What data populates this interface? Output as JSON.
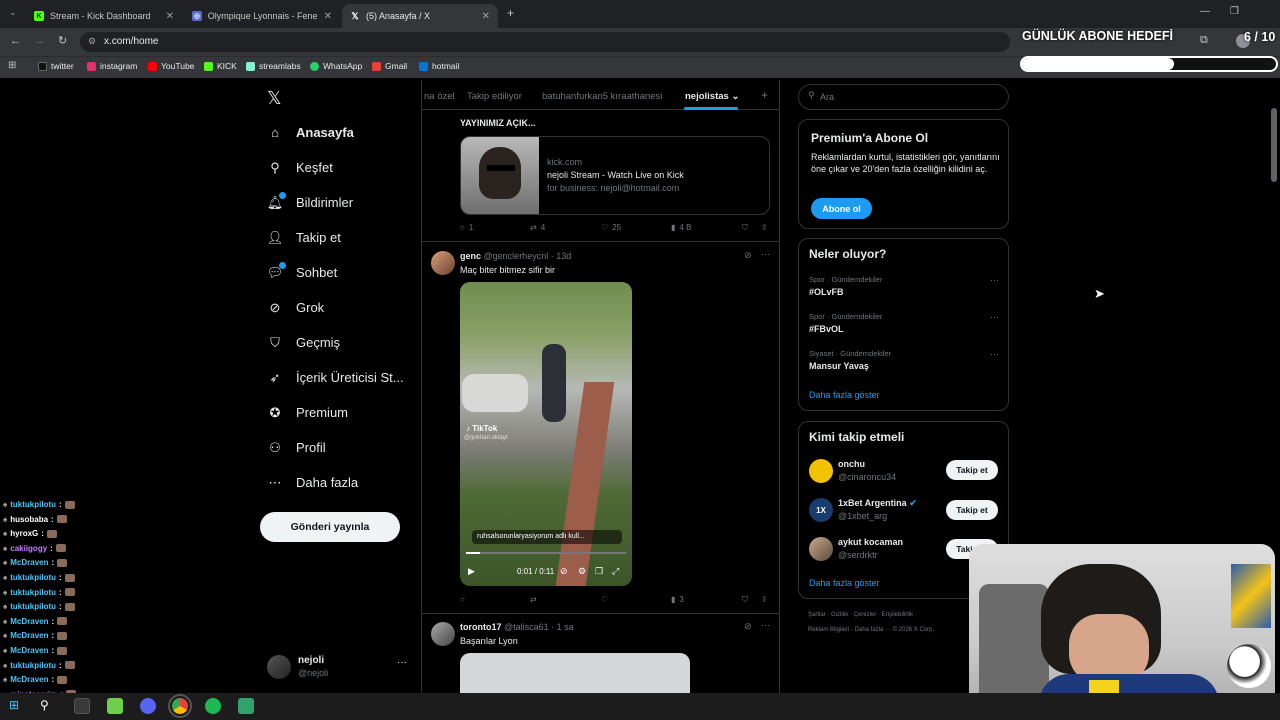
{
  "browser": {
    "tabs": [
      {
        "title": "Stream - Kick Dashboard",
        "icon": "kick-icon",
        "active": false
      },
      {
        "title": "Olympique Lyonnais - Fenerbahçe",
        "icon": "globe-icon",
        "active": false
      },
      {
        "title": "(5) Anasayfa / X",
        "icon": "x-logo-icon",
        "active": true
      }
    ],
    "new_tab": "+",
    "url": "x.com/home",
    "bookmarks": [
      {
        "label": "twitter",
        "color": "#000000"
      },
      {
        "label": "instagram",
        "color": "#e1306c"
      },
      {
        "label": "YouTube",
        "color": "#ff0000"
      },
      {
        "label": "KICK",
        "color": "#53fc18"
      },
      {
        "label": "streamlabs",
        "color": "#80f5d2"
      },
      {
        "label": "WhatsApp",
        "color": "#25d366"
      },
      {
        "label": "Gmail",
        "color": "#ea4335"
      },
      {
        "label": "hotmail",
        "color": "#0078d4"
      }
    ]
  },
  "overlay": {
    "goal_title": "GÜNLÜK ABONE HEDEFİ",
    "goal_count": "6 / 10",
    "goal_progress": 0.6
  },
  "sidebar": {
    "items": [
      {
        "label": "Anasayfa",
        "icon": "home-icon"
      },
      {
        "label": "Keşfet",
        "icon": "search-icon"
      },
      {
        "label": "Bildirimler",
        "icon": "bell-icon"
      },
      {
        "label": "Takip et",
        "icon": "add-user-icon"
      },
      {
        "label": "Sohbet",
        "icon": "chat-icon"
      },
      {
        "label": "Grok",
        "icon": "grok-icon"
      },
      {
        "label": "Geçmiş",
        "icon": "bookmark-icon"
      },
      {
        "label": "İçerik Üreticisi St...",
        "icon": "rocket-icon"
      },
      {
        "label": "Premium",
        "icon": "verified-icon"
      },
      {
        "label": "Profil",
        "icon": "person-icon"
      },
      {
        "label": "Daha fazla",
        "icon": "more-circle-icon"
      }
    ],
    "post_button": "Gönderi yayınla",
    "account": {
      "name": "nejoli",
      "handle": "@nejoli",
      "more": "···"
    }
  },
  "feed": {
    "tabs": [
      "na özel",
      "Takip ediliyor",
      "batuhanfurkan5 kıraathanesi",
      "nejolistas"
    ],
    "add_tab": "+",
    "post1": {
      "text": "YAYINIMIZ AÇIK...",
      "link_domain": "kick.com",
      "link_title": "nejoli Stream - Watch Live on Kick",
      "link_desc": "for business: nejoli@hotmail.com",
      "replies": "1",
      "reposts": "4",
      "likes": "25",
      "views": "4 B"
    },
    "post2": {
      "name": "genc",
      "meta": "@genclerheycnl · 13d",
      "text": "Maç biter bitmez sifir bir",
      "video_watermark": "TikTok",
      "video_user": "@gokhan.oktayt",
      "video_caption": "ruhsalsorunlaryasiyorum adlı kull...",
      "time": "0:01 / 0:11",
      "replies": "",
      "reposts": "",
      "likes": "",
      "views": "3"
    },
    "post3": {
      "name": "toronto17",
      "meta": "@talisca61 · 1 sa",
      "text": "Başarılar Lyon"
    }
  },
  "right": {
    "search_placeholder": "Ara",
    "premium": {
      "title": "Premium'a Abone Ol",
      "desc": "Reklamlardan kurtul, istatistikleri gör, yanıtlarını öne çıkar ve 20'den fazla özelliğin kilidini aç.",
      "button": "Abone ol"
    },
    "trends": {
      "title": "Neler oluyor?",
      "items": [
        {
          "category": "Spor · Gündemdekiler",
          "name": "#OLvFB"
        },
        {
          "category": "Spor · Gündemdekiler",
          "name": "#FBvOL"
        },
        {
          "category": "Siyaset · Gündemdekiler",
          "name": "Mansur Yavaş"
        }
      ],
      "more": "Daha fazla göster"
    },
    "who_to_follow": {
      "title": "Kimi takip etmeli",
      "items": [
        {
          "name": "onchu",
          "handle": "@cinaroncu34",
          "button": "Takip et"
        },
        {
          "name": "1xBet Argentina",
          "handle": "@1xbet_arg",
          "button": "Takip et"
        },
        {
          "name": "aykut kocaman",
          "handle": "@serdrktr",
          "button": "Takip et"
        }
      ],
      "more": "Daha fazla göster"
    },
    "footer_line1": "Şartlar · Gizlilik · Çerezler · Erişilebilirlik ·",
    "footer_line2": "Reklam Bilgileri · Daha fazla ··· © 2026 X Corp."
  },
  "chat": [
    {
      "user": "tuktukpilotu",
      "color": "#4fc3f7"
    },
    {
      "user": "husobaba",
      "color": "#ffffff"
    },
    {
      "user": "hyroxG",
      "color": "#ffffff"
    },
    {
      "user": "cakiigogy",
      "color": "#c87dff"
    },
    {
      "user": "McDraven",
      "color": "#4fc3f7"
    },
    {
      "user": "tuktukpilotu",
      "color": "#4fc3f7"
    },
    {
      "user": "tuktukpilotu",
      "color": "#4fc3f7"
    },
    {
      "user": "tuktukpilotu",
      "color": "#4fc3f7"
    },
    {
      "user": "McDraven",
      "color": "#4fc3f7"
    },
    {
      "user": "McDraven",
      "color": "#4fc3f7"
    },
    {
      "user": "McDraven",
      "color": "#4fc3f7"
    },
    {
      "user": "tuktukpilotu",
      "color": "#4fc3f7"
    },
    {
      "user": "McDraven",
      "color": "#4fc3f7"
    },
    {
      "user": "minatasarim",
      "color": "#c87dff"
    }
  ]
}
